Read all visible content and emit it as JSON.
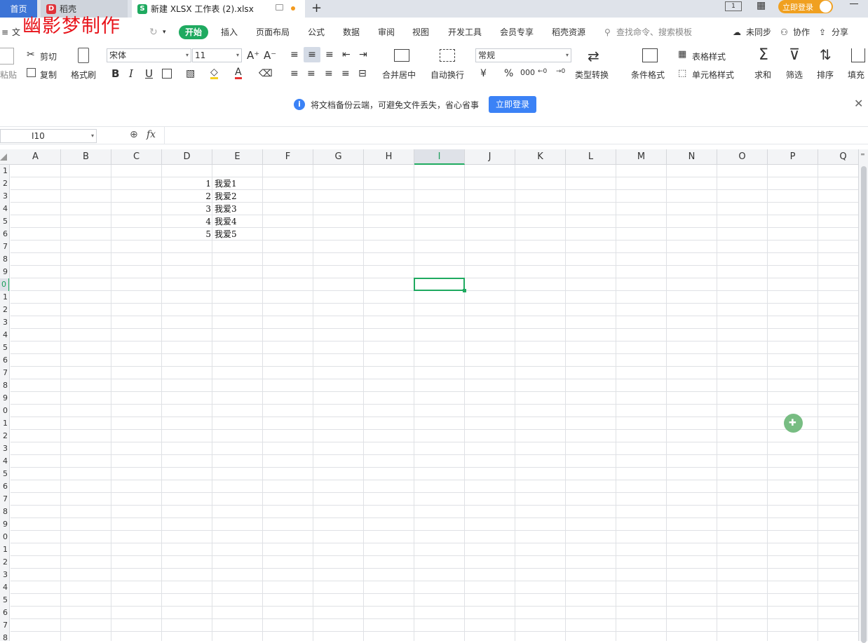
{
  "tabs": {
    "home": "首页",
    "daoke": "稻壳",
    "file": "新建 XLSX 工作表 (2).xlsx",
    "new_tab": "+"
  },
  "watermark": "幽影梦制作",
  "window": {
    "login": "立即登录"
  },
  "menu": {
    "file": "文",
    "items": [
      "开始",
      "插入",
      "页面布局",
      "公式",
      "数据",
      "审阅",
      "视图",
      "开发工具",
      "会员专享",
      "稻壳资源"
    ],
    "search_placeholder": "查找命令、搜索模板",
    "unsync": "未同步",
    "collab": "协作",
    "share": "分享"
  },
  "ribbon": {
    "paste": "粘贴",
    "cut": "剪切",
    "copy": "复制",
    "format_painter": "格式刷",
    "font_name": "宋体",
    "font_size": "11",
    "merge_center": "合并居中",
    "auto_wrap": "自动换行",
    "number_format": "常规",
    "currency": "¥",
    "percent": "%",
    "thousands": "000",
    "type_convert": "类型转换",
    "conditional_format": "条件格式",
    "table_style": "表格样式",
    "cell_style": "单元格样式",
    "sum": "求和",
    "filter": "筛选",
    "sort": "排序",
    "fill": "填充"
  },
  "notice": {
    "text": "将文档备份云端，可避免文件丢失，省心省事",
    "button": "立即登录"
  },
  "formula": {
    "cell_ref": "I10",
    "fx": "fx",
    "value": ""
  },
  "columns": [
    "A",
    "B",
    "C",
    "D",
    "E",
    "F",
    "G",
    "H",
    "I",
    "J",
    "K",
    "L",
    "M",
    "N",
    "O",
    "P",
    "Q"
  ],
  "active_column": "I",
  "rows": [
    "1",
    "2",
    "3",
    "4",
    "5",
    "6",
    "7",
    "8",
    "9",
    "0",
    "1",
    "2",
    "3",
    "4",
    "5",
    "6",
    "7",
    "8",
    "9",
    "0",
    "1",
    "2",
    "3",
    "4",
    "5",
    "6",
    "7",
    "8",
    "9",
    "0",
    "1",
    "2",
    "3",
    "4",
    "5",
    "6",
    "7",
    "8"
  ],
  "active_row_index": 9,
  "cells": {
    "D": [
      "1",
      "2",
      "3",
      "4",
      "5"
    ],
    "E": [
      "我爱1",
      "我爱2",
      "我爱3",
      "我爱4",
      "我爱5"
    ]
  },
  "colors": {
    "accent_green": "#1faa60",
    "tab_blue": "#3c74d6",
    "notice_button": "#3b82f6",
    "watermark": "#e8141b"
  }
}
